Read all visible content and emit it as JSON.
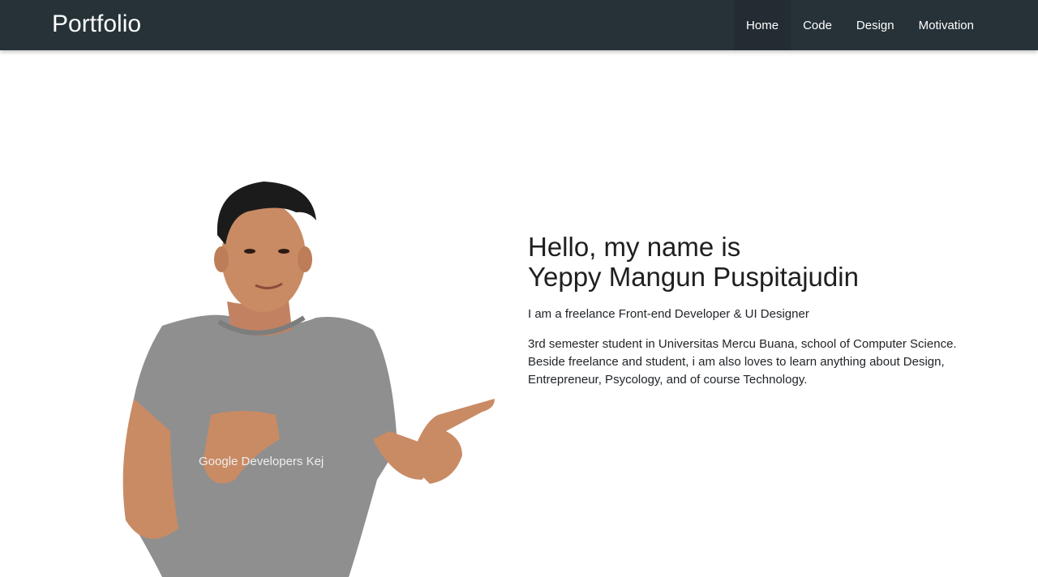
{
  "navbar": {
    "brand": "Portfolio",
    "items": [
      {
        "label": "Home",
        "active": true
      },
      {
        "label": "Code",
        "active": false
      },
      {
        "label": "Design",
        "active": false
      },
      {
        "label": "Motivation",
        "active": false
      }
    ]
  },
  "hero": {
    "greeting_line1": "Hello, my name is",
    "greeting_line2": "Yeppy Mangun Puspitajudin",
    "tagline": "I am a freelance Front-end Developer & UI Designer",
    "bio_lines": [
      "3rd semester student in Universitas Mercu Buana, school of Computer Science.",
      "Beside freelance and student, i am also loves to learn anything about Design,",
      "Entrepreneur, Psycology, and of course Technology."
    ],
    "photo": {
      "shirt_text": "Google Developers Kej"
    }
  },
  "colors": {
    "navbar_bg": "#263238",
    "nav_text": "#ffffff",
    "body_text": "#212529",
    "shirt": "#8f8f8f",
    "skin": "#c98b64",
    "hair": "#1b1b1b"
  }
}
